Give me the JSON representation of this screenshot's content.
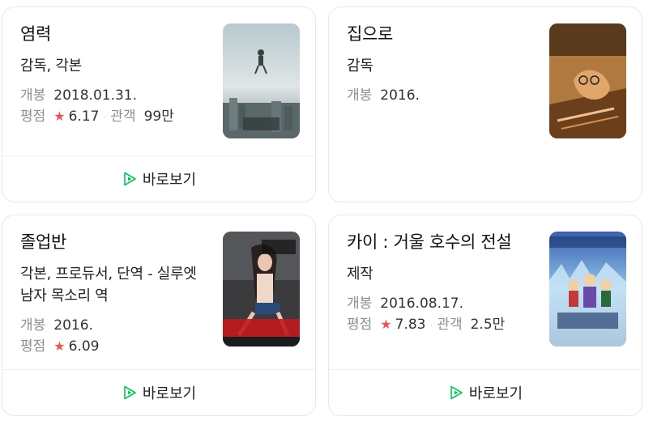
{
  "cards": [
    {
      "title": "염력",
      "role": "감독, 각본",
      "release_label": "개봉",
      "release_value": "2018.01.31.",
      "rating_label": "평점",
      "rating_star": "★",
      "rating_value": "6.17",
      "separator": "·",
      "audience_label": "관객",
      "audience_value": "99만",
      "watch_label": "바로보기"
    },
    {
      "title": "집으로",
      "role": "감독",
      "release_label": "개봉",
      "release_value": "2016."
    },
    {
      "title": "졸업반",
      "role": "각본, 프로듀서, 단역 - 실루엣 남자 목소리 역",
      "release_label": "개봉",
      "release_value": "2016.",
      "rating_label": "평점",
      "rating_star": "★",
      "rating_value": "6.09",
      "watch_label": "바로보기"
    },
    {
      "title": "카이 : 거울 호수의 전설",
      "role": "제작",
      "release_label": "개봉",
      "release_value": "2016.08.17.",
      "rating_label": "평점",
      "rating_star": "★",
      "rating_value": "7.83",
      "separator": "·",
      "audience_label": "관객",
      "audience_value": "2.5만",
      "watch_label": "바로보기"
    }
  ],
  "colors": {
    "play_icon": "#03c75a",
    "star": "#f0544f",
    "label": "#8a8f94"
  }
}
